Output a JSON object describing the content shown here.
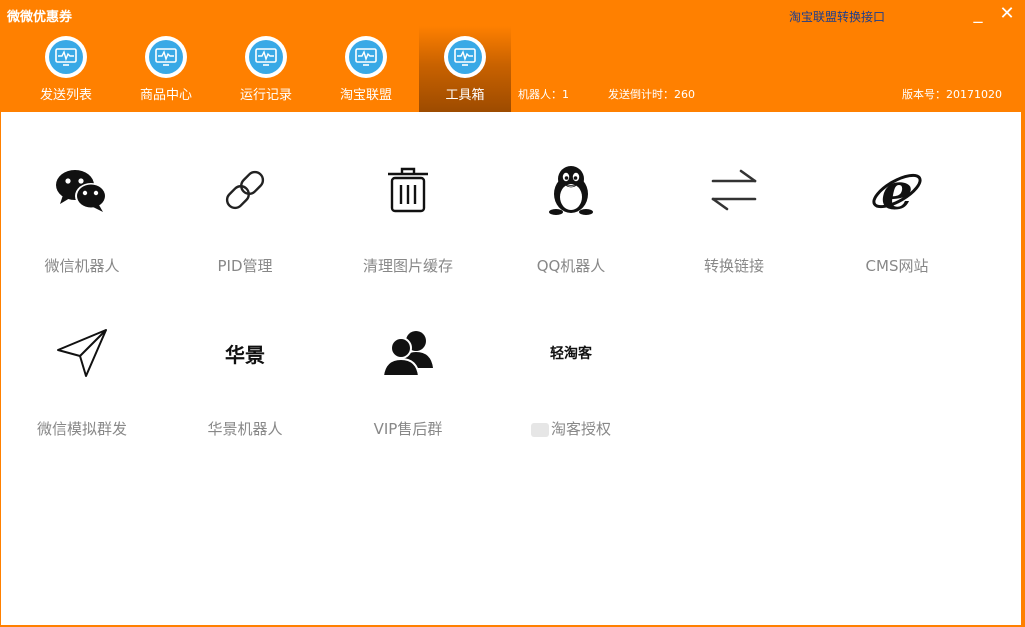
{
  "window": {
    "title": "微微优惠券",
    "link_title": "淘宝联盟转换接口",
    "minimize_symbol": "_",
    "close_symbol": "✕"
  },
  "tabs": [
    {
      "label": "发送列表",
      "icon": "monitor-icon",
      "active": false
    },
    {
      "label": "商品中心",
      "icon": "monitor-icon",
      "active": false
    },
    {
      "label": "运行记录",
      "icon": "monitor-icon",
      "active": false
    },
    {
      "label": "淘宝联盟",
      "icon": "monitor-icon",
      "active": false
    },
    {
      "label": "工具箱",
      "icon": "monitor-icon",
      "active": true
    }
  ],
  "status": {
    "robot": "机器人：1",
    "countdown": "发送倒计时：260",
    "version": "版本号：20171020"
  },
  "tools": [
    {
      "label": "微信机器人",
      "icon": "wechat-icon"
    },
    {
      "label": "PID管理",
      "icon": "link-icon"
    },
    {
      "label": "清理图片缓存",
      "icon": "trash-icon"
    },
    {
      "label": "QQ机器人",
      "icon": "qq-penguin-icon"
    },
    {
      "label": "转换链接",
      "icon": "swap-arrows-icon"
    },
    {
      "label": "CMS网站",
      "icon": "ie-browser-icon"
    },
    {
      "label": "微信模拟群发",
      "icon": "paper-plane-icon"
    },
    {
      "label": "华景机器人",
      "icon": "huajing-logo",
      "logo_text": "华景"
    },
    {
      "label": "VIP售后群",
      "icon": "users-icon"
    },
    {
      "label": "淘客授权",
      "icon": "qingtaoke-logo",
      "logo_text": "轻淘客"
    }
  ],
  "colors": {
    "brand_orange": "#ff8000",
    "active_tab": "#9d4b00",
    "tab_icon_blue": "#39a9e6",
    "link_blue": "#1a3d8f",
    "label_gray": "#888888"
  }
}
